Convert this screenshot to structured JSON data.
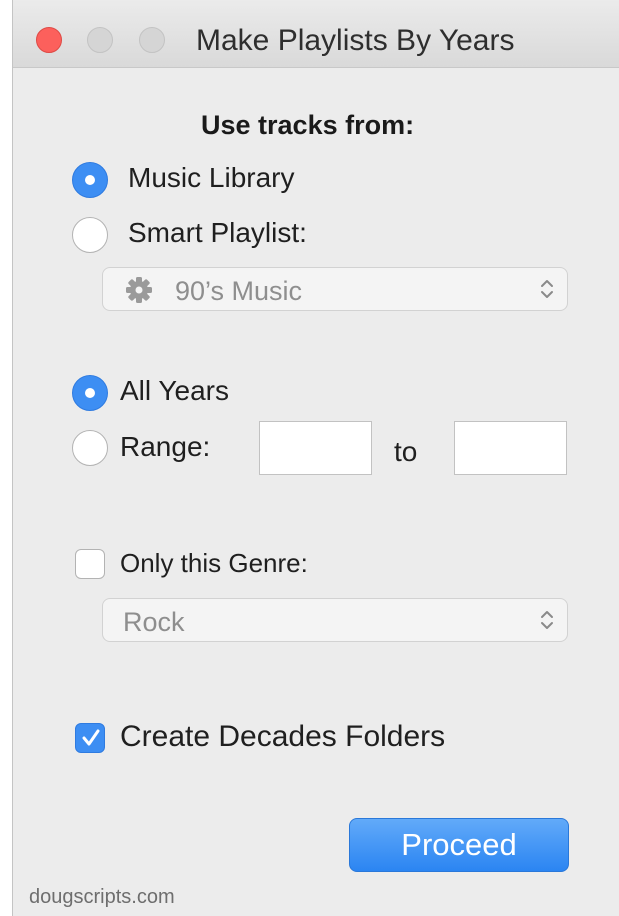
{
  "window": {
    "title": "Make Playlists By Years"
  },
  "source": {
    "heading": "Use tracks from:",
    "music_library_label": "Music Library",
    "music_library_selected": true,
    "smart_playlist_label": "Smart Playlist:",
    "smart_playlist_selected": false,
    "smart_playlist_value": "90’s Music",
    "smart_playlist_icon": "gear-icon"
  },
  "years": {
    "all_years_label": "All Years",
    "all_years_selected": true,
    "range_label": "Range:",
    "range_selected": false,
    "range_from_value": "",
    "range_to_word": "to",
    "range_to_value": ""
  },
  "genre": {
    "only_genre_label": "Only this Genre:",
    "only_genre_checked": false,
    "genre_value": "Rock"
  },
  "options": {
    "create_decades_label": "Create Decades Folders",
    "create_decades_checked": true
  },
  "actions": {
    "proceed_label": "Proceed"
  },
  "footer": {
    "credit": "dougscripts.com"
  },
  "colors": {
    "accent": "#3d8ef3",
    "close": "#fc605c",
    "window_bg": "#ececec"
  }
}
